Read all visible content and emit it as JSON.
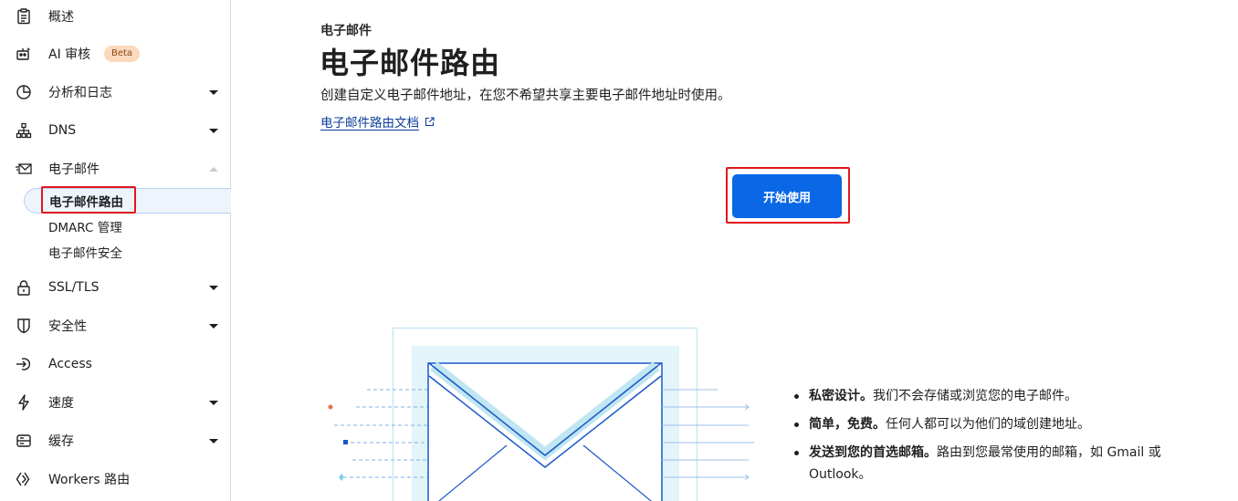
{
  "sidebar": {
    "items": [
      {
        "label": "概述",
        "icon": "clipboard-icon"
      },
      {
        "label": "AI 审核",
        "icon": "robot-icon",
        "badge": "Beta"
      },
      {
        "label": "分析和日志",
        "icon": "pie-chart-icon",
        "expandable": true
      },
      {
        "label": "DNS",
        "icon": "network-icon",
        "expandable": true
      },
      {
        "label": "电子邮件",
        "icon": "envelope-icon",
        "expanded": true
      },
      {
        "label": "SSL/TLS",
        "icon": "lock-icon",
        "expandable": true
      },
      {
        "label": "安全性",
        "icon": "shield-icon",
        "expandable": true
      },
      {
        "label": "Access",
        "icon": "access-icon"
      },
      {
        "label": "速度",
        "icon": "lightning-icon",
        "expandable": true
      },
      {
        "label": "缓存",
        "icon": "storage-icon",
        "expandable": true
      },
      {
        "label": "Workers 路由",
        "icon": "workers-icon"
      }
    ],
    "email_sub": [
      {
        "label": "电子邮件路由",
        "active": true
      },
      {
        "label": "DMARC 管理"
      },
      {
        "label": "电子邮件安全"
      }
    ]
  },
  "main": {
    "eyebrow": "电子邮件",
    "title": "电子邮件路由",
    "description": "创建自定义电子邮件地址，在您不希望共享主要电子邮件地址时使用。",
    "doc_link": "电子邮件路由文档",
    "start_button": "开始使用",
    "features": [
      {
        "bold": "私密设计。",
        "text": "我们不会存储或浏览您的电子邮件。"
      },
      {
        "bold": "简单，免费。",
        "text": "任何人都可以为他们的域创建地址。"
      },
      {
        "bold": "发送到您的首选邮箱。",
        "text": "路由到您最常使用的邮箱，如 Gmail 或 Outlook。"
      }
    ]
  },
  "colors": {
    "accent": "#0a68e6",
    "link": "#0b3e9a",
    "highlight": "#e0171f",
    "illustration_line": "#1a56c9",
    "illustration_light": "#bfe6f2"
  }
}
